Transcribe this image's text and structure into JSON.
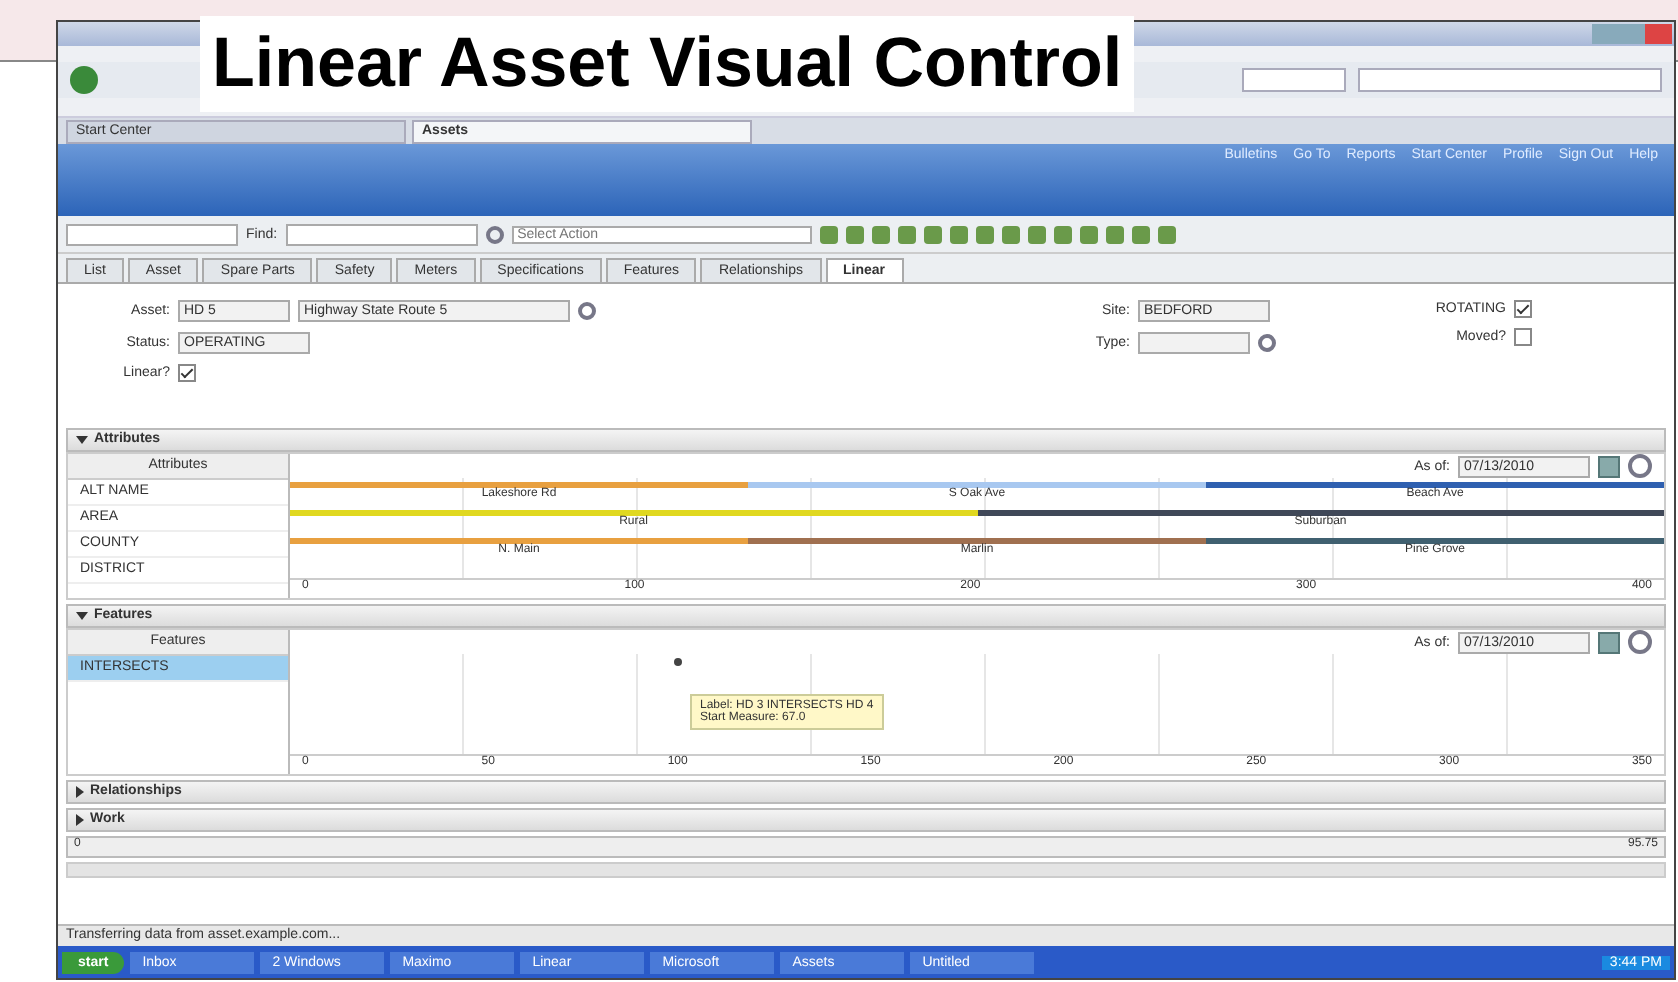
{
  "overlay_title": "Linear Asset Visual Control",
  "browser": {
    "tabs": [
      {
        "label": "Start Center",
        "selected": false
      },
      {
        "label": "Assets",
        "selected": true
      }
    ]
  },
  "app": {
    "nav_links": [
      "Bulletins",
      "Go To",
      "Reports",
      "Start Center",
      "Profile",
      "Sign Out",
      "Help"
    ],
    "toolbar": {
      "find_label": "Find:",
      "action_placeholder": "Select Action"
    },
    "tabs": [
      {
        "label": "List",
        "selected": false
      },
      {
        "label": "Asset",
        "selected": false
      },
      {
        "label": "Spare Parts",
        "selected": false
      },
      {
        "label": "Safety",
        "selected": false
      },
      {
        "label": "Meters",
        "selected": false
      },
      {
        "label": "Specifications",
        "selected": false
      },
      {
        "label": "Features",
        "selected": false
      },
      {
        "label": "Relationships",
        "selected": false
      },
      {
        "label": "Linear",
        "selected": true
      }
    ],
    "form": {
      "asset_label": "Asset:",
      "asset": "HD 5",
      "description": "Highway State Route 5",
      "status_label": "Status:",
      "status": "OPERATING",
      "linear_label": "Linear?",
      "linear": true,
      "site_label": "Site:",
      "site": "BEDFORD",
      "type_label": "Type:",
      "rotating_label": "ROTATING",
      "rotating": true,
      "moved_label": "Moved?",
      "moved": false
    },
    "attributes": {
      "title": "Attributes",
      "column": "Attributes",
      "as_of_label": "As of:",
      "as_of": "07/13/2010",
      "rows": [
        "ALT NAME",
        "AREA",
        "COUNTY",
        "DISTRICT"
      ],
      "tracks": [
        [
          {
            "label": "Lakeshore Rd",
            "color": "#e8a040"
          },
          {
            "label": "S Oak Ave",
            "color": "#a8c8f0"
          },
          {
            "label": "Beach Ave",
            "color": "#2f60b0"
          }
        ],
        [
          {
            "label": "Rural",
            "color": "#e0d820"
          },
          {
            "label": "Suburban",
            "color": "#404858"
          }
        ],
        [
          {
            "label": "N. Main",
            "color": "#e8a040"
          },
          {
            "label": "Marlin",
            "color": "#a07050"
          },
          {
            "label": "Pine Grove",
            "color": "#406070"
          }
        ]
      ],
      "ticks": [
        "0",
        "100",
        "200",
        "300",
        "400"
      ]
    },
    "features": {
      "title": "Features",
      "column": "Features",
      "as_of_label": "As of:",
      "as_of": "07/13/2010",
      "rows": [
        {
          "label": "INTERSECTS",
          "selected": true
        }
      ],
      "tooltip": [
        "Label: HD 3 INTERSECTS HD 4",
        "Start Measure: 67.0"
      ],
      "ticks": [
        "0",
        "50",
        "100",
        "150",
        "200",
        "250",
        "300",
        "350"
      ]
    },
    "relationships": {
      "title": "Relationships",
      "expanded": false
    },
    "work": {
      "title": "Work",
      "expanded": false,
      "start": "0",
      "end": "95.75"
    },
    "status_bar": "Transferring data from asset.example.com...",
    "taskbar": {
      "start": "start",
      "items": [
        "Inbox",
        "2 Windows",
        "Maximo",
        "Linear",
        "Microsoft",
        "Assets",
        "Untitled"
      ],
      "clock": "3:44 PM"
    }
  }
}
